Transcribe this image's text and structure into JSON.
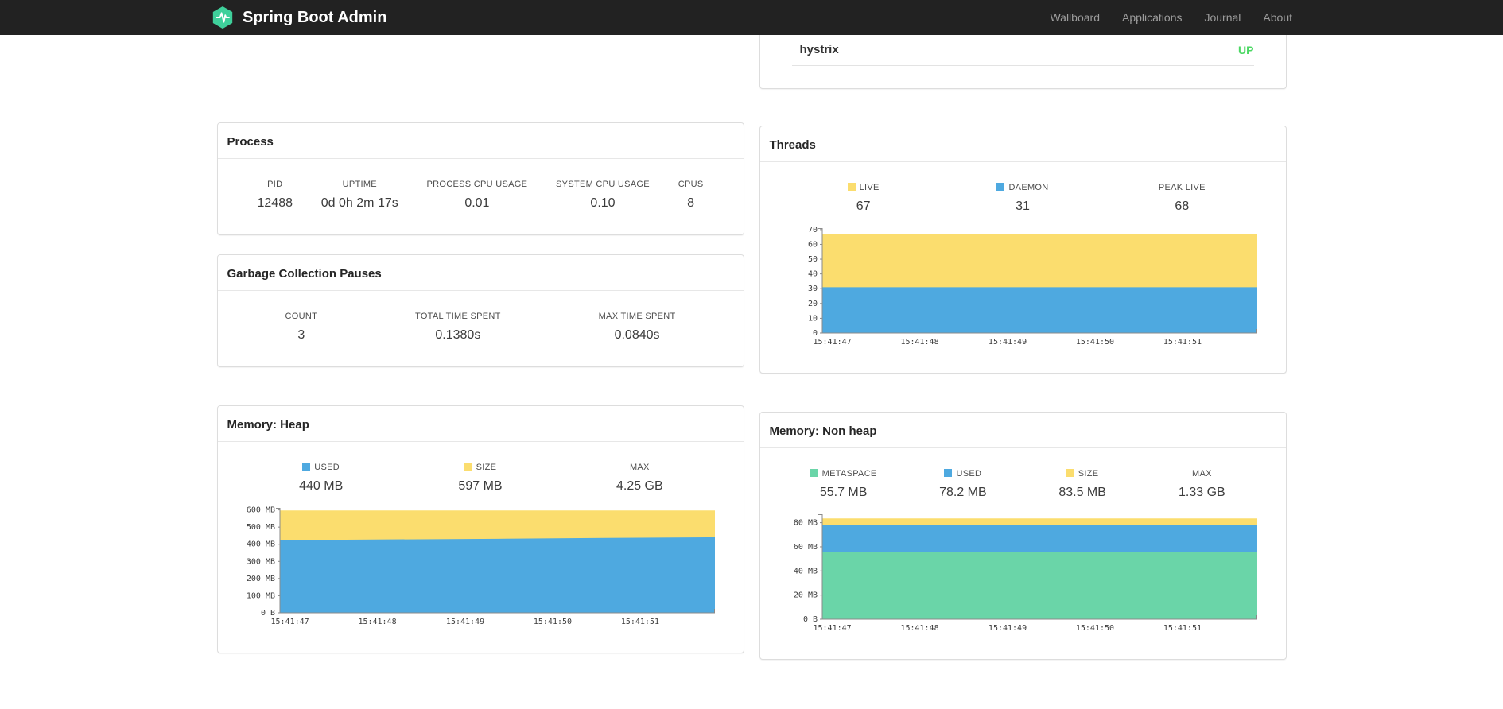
{
  "colors": {
    "brand": "#3FD09B",
    "status_up": "#4BD863",
    "chart_blue": "#4EA9E0",
    "chart_yellow": "#FBDD6E",
    "chart_green": "#6AD5A8"
  },
  "navbar": {
    "brand": "Spring Boot Admin",
    "links": [
      {
        "label": "Wallboard"
      },
      {
        "label": "Applications"
      },
      {
        "label": "Journal"
      },
      {
        "label": "About"
      }
    ]
  },
  "applications": {
    "items": [
      {
        "name": "hystrix",
        "status": "UP"
      }
    ]
  },
  "process": {
    "title": "Process",
    "stats": [
      {
        "label": "PID",
        "value": "12488"
      },
      {
        "label": "UPTIME",
        "value": "0d 0h 2m 17s"
      },
      {
        "label": "PROCESS CPU USAGE",
        "value": "0.01"
      },
      {
        "label": "SYSTEM CPU USAGE",
        "value": "0.10"
      },
      {
        "label": "CPUS",
        "value": "8"
      }
    ]
  },
  "gc": {
    "title": "Garbage Collection Pauses",
    "stats": [
      {
        "label": "COUNT",
        "value": "3"
      },
      {
        "label": "TOTAL TIME SPENT",
        "value": "0.1380s"
      },
      {
        "label": "MAX TIME SPENT",
        "value": "0.0840s"
      }
    ]
  },
  "threads": {
    "title": "Threads",
    "stats": [
      {
        "label": "LIVE",
        "value": "67",
        "color": "#FBDD6E"
      },
      {
        "label": "DAEMON",
        "value": "31",
        "color": "#4EA9E0"
      },
      {
        "label": "PEAK LIVE",
        "value": "68"
      }
    ]
  },
  "memory_heap": {
    "title": "Memory: Heap",
    "stats": [
      {
        "label": "USED",
        "value": "440 MB",
        "color": "#4EA9E0"
      },
      {
        "label": "SIZE",
        "value": "597 MB",
        "color": "#FBDD6E"
      },
      {
        "label": "MAX",
        "value": "4.25 GB"
      }
    ]
  },
  "memory_nonheap": {
    "title": "Memory: Non heap",
    "stats": [
      {
        "label": "METASPACE",
        "value": "55.7 MB",
        "color": "#6AD5A8"
      },
      {
        "label": "USED",
        "value": "78.2 MB",
        "color": "#4EA9E0"
      },
      {
        "label": "SIZE",
        "value": "83.5 MB",
        "color": "#FBDD6E"
      },
      {
        "label": "MAX",
        "value": "1.33 GB"
      }
    ]
  },
  "chart_data": [
    {
      "id": "threads",
      "type": "area",
      "title": "Threads",
      "xlabel": "",
      "ylabel": "",
      "ylim": [
        0,
        71
      ],
      "ymax": 71,
      "x_labels": [
        "15:41:47",
        "15:41:48",
        "15:41:49",
        "15:41:50",
        "15:41:51"
      ],
      "x_tick_pos": [
        0.023,
        0.224,
        0.426,
        0.627,
        0.828
      ],
      "y_ticks": [
        {
          "v": 0,
          "label": "0"
        },
        {
          "v": 10,
          "label": "10"
        },
        {
          "v": 20,
          "label": "20"
        },
        {
          "v": 30,
          "label": "30"
        },
        {
          "v": 40,
          "label": "40"
        },
        {
          "v": 50,
          "label": "50"
        },
        {
          "v": 60,
          "label": "60"
        },
        {
          "v": 70,
          "label": "70"
        }
      ],
      "series": [
        {
          "name": "LIVE",
          "color": "#FBDD6E",
          "values": [
            67,
            67,
            67,
            67,
            67
          ]
        },
        {
          "name": "DAEMON",
          "color": "#4EA9E0",
          "values": [
            31,
            31,
            31,
            31,
            31
          ]
        }
      ]
    },
    {
      "id": "memory-heap",
      "type": "area",
      "title": "Memory: Heap (MB)",
      "xlabel": "",
      "ylabel": "",
      "ylim": [
        0,
        612
      ],
      "ymax": 612,
      "x_labels": [
        "15:41:47",
        "15:41:48",
        "15:41:49",
        "15:41:50",
        "15:41:51"
      ],
      "x_tick_pos": [
        0.023,
        0.224,
        0.426,
        0.627,
        0.828
      ],
      "y_ticks": [
        {
          "v": 0,
          "label": "0 B"
        },
        {
          "v": 100,
          "label": "100 MB"
        },
        {
          "v": 200,
          "label": "200 MB"
        },
        {
          "v": 300,
          "label": "300 MB"
        },
        {
          "v": 400,
          "label": "400 MB"
        },
        {
          "v": 500,
          "label": "500 MB"
        },
        {
          "v": 600,
          "label": "600 MB"
        }
      ],
      "series": [
        {
          "name": "SIZE",
          "color": "#FBDD6E",
          "values": [
            597,
            597,
            597,
            597,
            597
          ]
        },
        {
          "name": "USED",
          "color": "#4EA9E0",
          "values": [
            424,
            428,
            432,
            437,
            441
          ]
        }
      ]
    },
    {
      "id": "memory-nonheap",
      "type": "area",
      "title": "Memory: Non heap (MB)",
      "xlabel": "",
      "ylabel": "",
      "ylim": [
        0,
        87
      ],
      "ymax": 87,
      "x_labels": [
        "15:41:47",
        "15:41:48",
        "15:41:49",
        "15:41:50",
        "15:41:51"
      ],
      "x_tick_pos": [
        0.023,
        0.224,
        0.426,
        0.627,
        0.828
      ],
      "y_ticks": [
        {
          "v": 0,
          "label": "0 B"
        },
        {
          "v": 20,
          "label": "20 MB"
        },
        {
          "v": 40,
          "label": "40 MB"
        },
        {
          "v": 60,
          "label": "60 MB"
        },
        {
          "v": 80,
          "label": "80 MB"
        }
      ],
      "series": [
        {
          "name": "SIZE",
          "color": "#FBDD6E",
          "values": [
            83.5,
            83.5,
            83.5,
            83.5,
            83.5
          ]
        },
        {
          "name": "USED",
          "color": "#4EA9E0",
          "values": [
            78.2,
            78.2,
            78.2,
            78.2,
            78.2
          ]
        },
        {
          "name": "METASPACE",
          "color": "#6AD5A8",
          "values": [
            55.7,
            55.7,
            55.7,
            55.7,
            55.7
          ]
        }
      ]
    }
  ]
}
